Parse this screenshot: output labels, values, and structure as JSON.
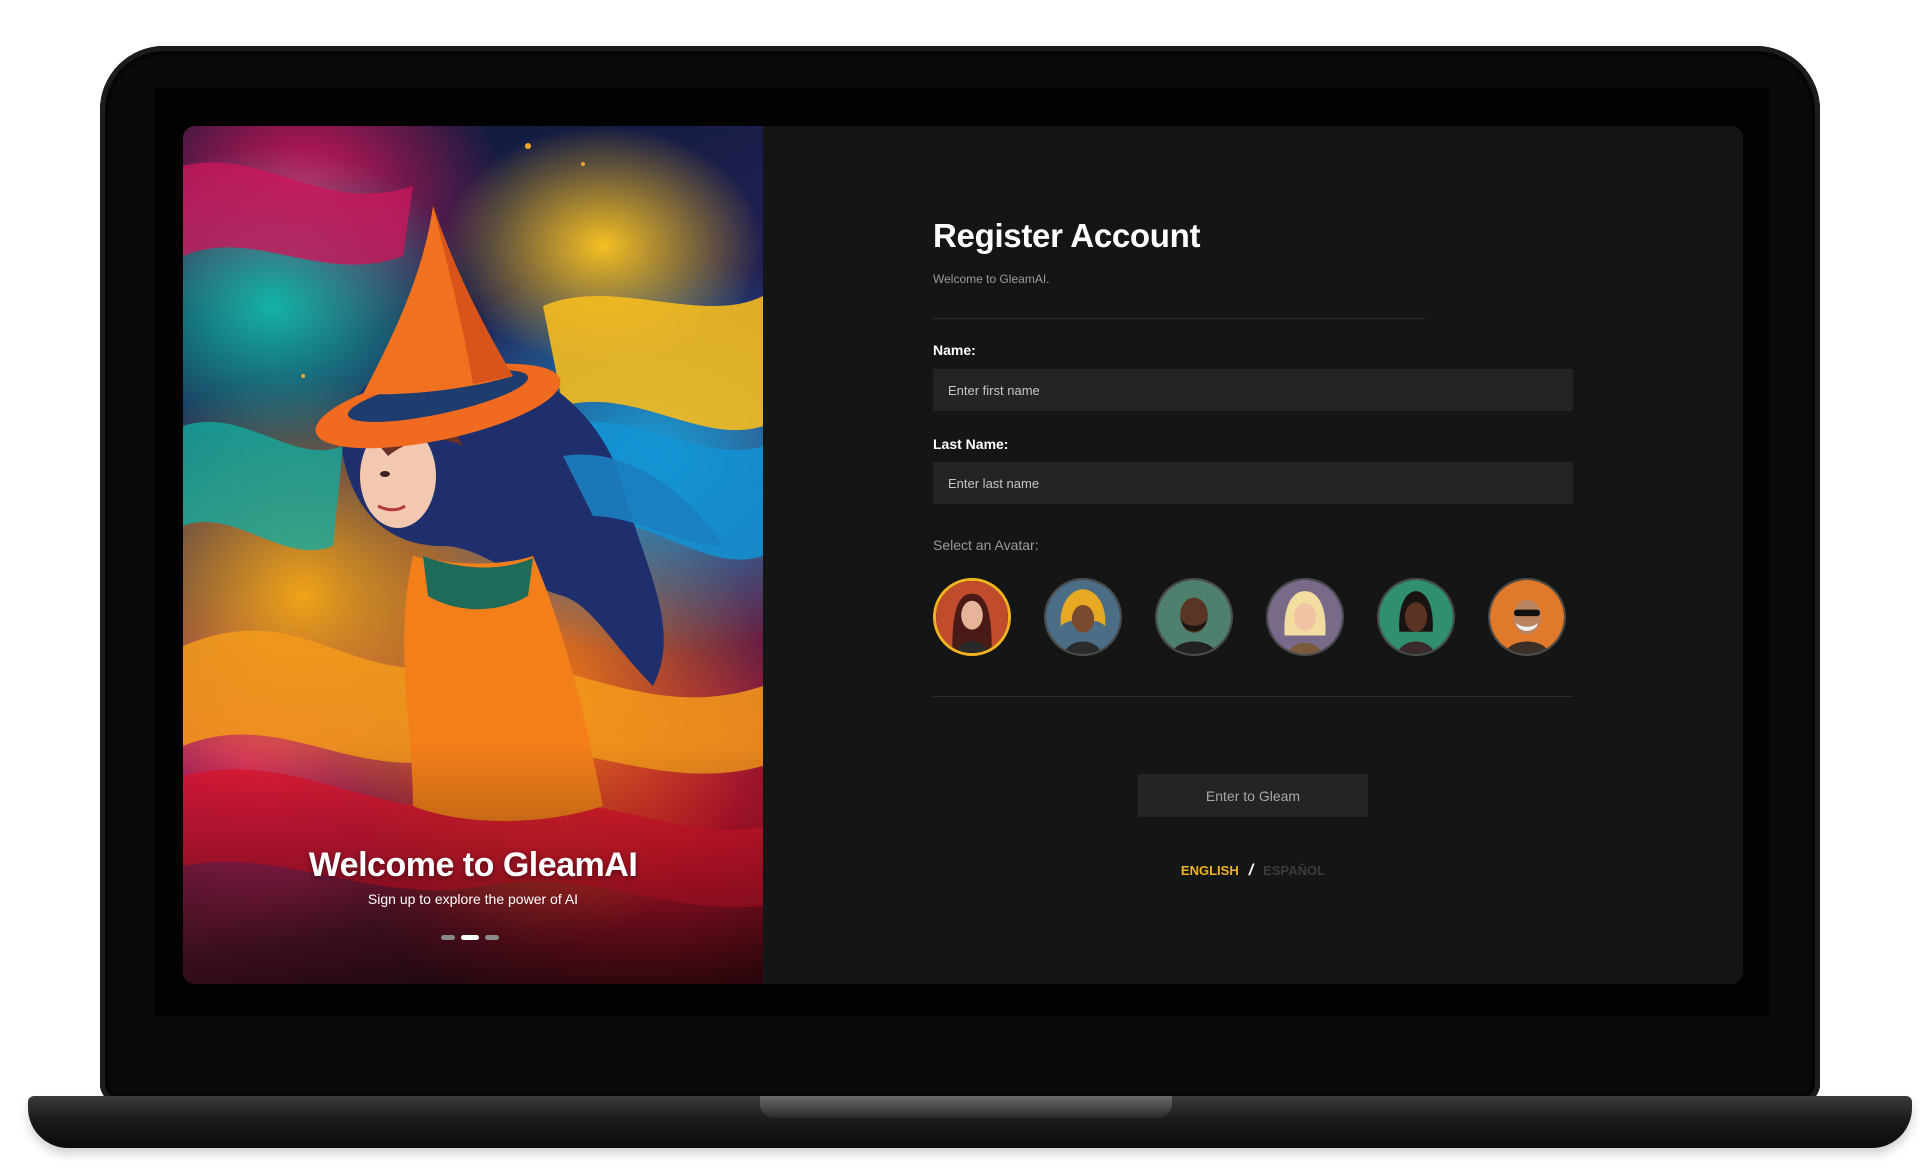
{
  "hero": {
    "title": "Welcome to GleamAI",
    "subtitle": "Sign up to explore the power of AI",
    "carousel_active_index": 1,
    "carousel_count": 3
  },
  "form": {
    "title": "Register Account",
    "subtitle": "Welcome to GleamAI.",
    "name_label": "Name:",
    "name_placeholder": "Enter first name",
    "name_value": "",
    "last_name_label": "Last Name:",
    "last_name_placeholder": "Enter last name",
    "last_name_value": "",
    "avatar_label": "Select an Avatar:",
    "avatars": [
      {
        "icon": "avatar-woman-red-hair-icon",
        "selected": true
      },
      {
        "icon": "avatar-woman-gold-headdress-icon",
        "selected": false
      },
      {
        "icon": "avatar-man-beard-icon",
        "selected": false
      },
      {
        "icon": "avatar-woman-blonde-icon",
        "selected": false
      },
      {
        "icon": "avatar-woman-green-bg-icon",
        "selected": false
      },
      {
        "icon": "avatar-man-sunglasses-icon",
        "selected": false
      }
    ],
    "submit_label": "Enter to Gleam"
  },
  "language": {
    "english": "ENGLISH",
    "separator": "/",
    "spanish": "ESPAÑOL",
    "active": "ENGLISH"
  },
  "colors": {
    "accent": "#f3b320",
    "background": "#141515",
    "field_bg": "#232424"
  }
}
